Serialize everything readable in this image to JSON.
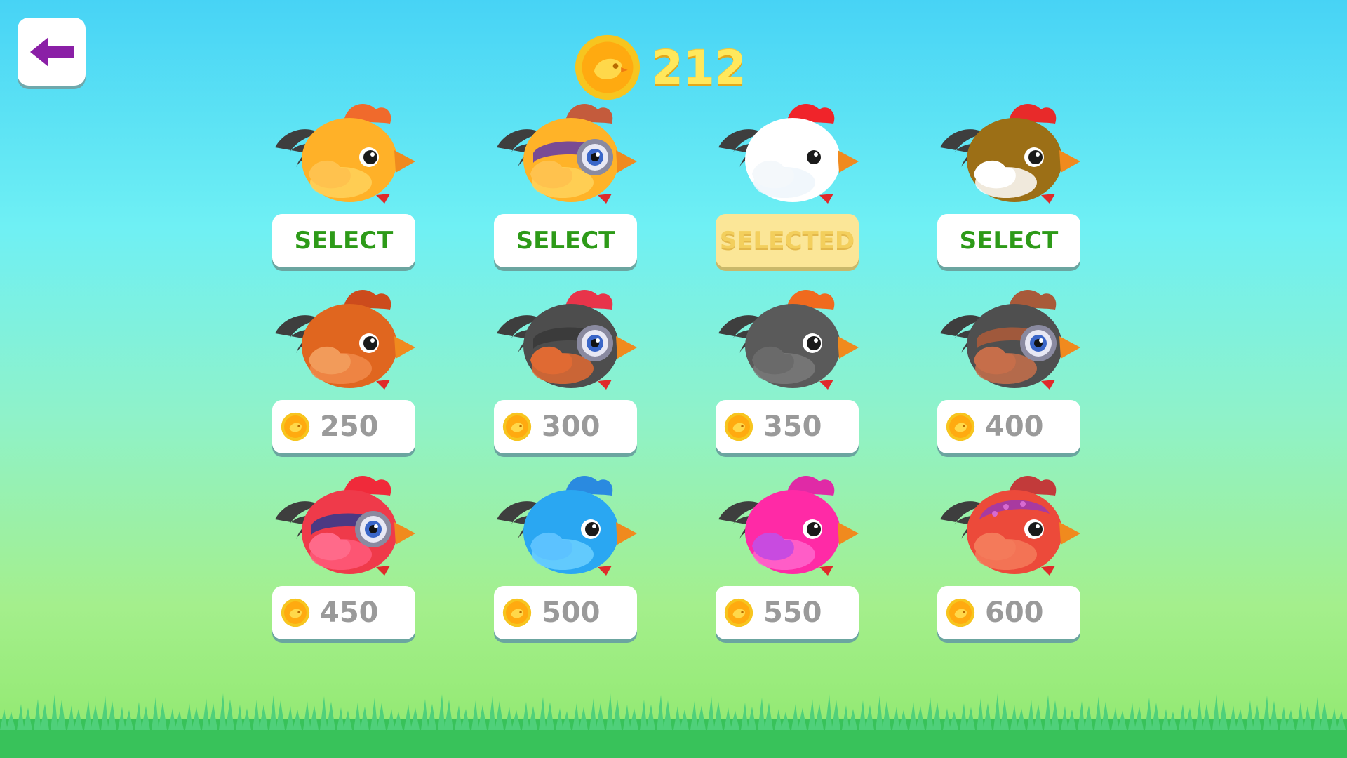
{
  "header": {
    "back_icon": "back-arrow-icon",
    "coin_icon": "coin-icon",
    "coins": "212"
  },
  "colors": {
    "accent_select": "#2d9a18",
    "selected_bg": "#fbe697",
    "coin_text": "#ffe85c",
    "back_arrow": "#8a1fa6"
  },
  "birds": [
    {
      "id": "orange-chicken",
      "state": "unlocked",
      "label": "SELECT",
      "body": "#ffb128",
      "belly": "#ffd25a",
      "wing": "#ffc24e",
      "crest": "#f06a2c",
      "goggles": false
    },
    {
      "id": "goggle-chicken",
      "state": "unlocked",
      "label": "SELECT",
      "body": "#ffb328",
      "belly": "#ffd25a",
      "wing": "#ffc24e",
      "crest": "#c45b3c",
      "goggles": true,
      "goggle_color": "#6a3fa0"
    },
    {
      "id": "white-chicken",
      "state": "selected",
      "label": "SELECTED",
      "body": "#ffffff",
      "belly": "#eef6fb",
      "wing": "#f4f8fb",
      "crest": "#f0242a",
      "goggles": false
    },
    {
      "id": "brown-chicken",
      "state": "unlocked",
      "label": "SELECT",
      "body": "#9c6f16",
      "belly": "#ffffff",
      "wing": "#ffffff",
      "crest": "#e82a2a",
      "goggles": false
    },
    {
      "id": "rust-chicken",
      "state": "locked",
      "price": "250",
      "body": "#e0661f",
      "belly": "#f08a4a",
      "wing": "#f29b5a",
      "crest": "#cc4b1c",
      "goggles": false
    },
    {
      "id": "black-goggle-chicken",
      "state": "locked",
      "price": "300",
      "body": "#4d4d4d",
      "belly": "#e06a33",
      "wing": "#e06a33",
      "crest": "#e8344a",
      "goggles": true,
      "goggle_color": "#3a3a3a"
    },
    {
      "id": "gray-chicken",
      "state": "locked",
      "price": "350",
      "body": "#5a5a5a",
      "belly": "#7a7a7a",
      "wing": "#6a6a6a",
      "crest": "#f06a1e",
      "goggles": false
    },
    {
      "id": "brown-cap-chicken",
      "state": "locked",
      "price": "400",
      "body": "#4f4f4f",
      "belly": "#c66e4a",
      "wing": "#c66e4a",
      "crest": "#a85a3a",
      "goggles": true,
      "goggle_color": "#a85a3a"
    },
    {
      "id": "red-goggle-chicken",
      "state": "locked",
      "price": "450",
      "body": "#ef3a4a",
      "belly": "#ff5a7a",
      "wing": "#ff6a8a",
      "crest": "#f02a3a",
      "goggles": true,
      "goggle_color": "#3a3a8a"
    },
    {
      "id": "blue-chicken",
      "state": "locked",
      "price": "500",
      "body": "#2aa7f2",
      "belly": "#6cd0ff",
      "wing": "#5cc2ff",
      "crest": "#2a8ae0",
      "goggles": false
    },
    {
      "id": "pink-chicken",
      "state": "locked",
      "price": "550",
      "body": "#ff2aa6",
      "belly": "#ff66cc",
      "wing": "#c84be0",
      "crest": "#e02aa6",
      "goggles": false
    },
    {
      "id": "red-cap-chicken",
      "state": "locked",
      "price": "600",
      "body": "#ec4a3a",
      "belly": "#f47a5a",
      "wing": "#f47a5a",
      "crest": "#c23a3a",
      "goggles": false,
      "cap": "#a83aa0"
    }
  ]
}
